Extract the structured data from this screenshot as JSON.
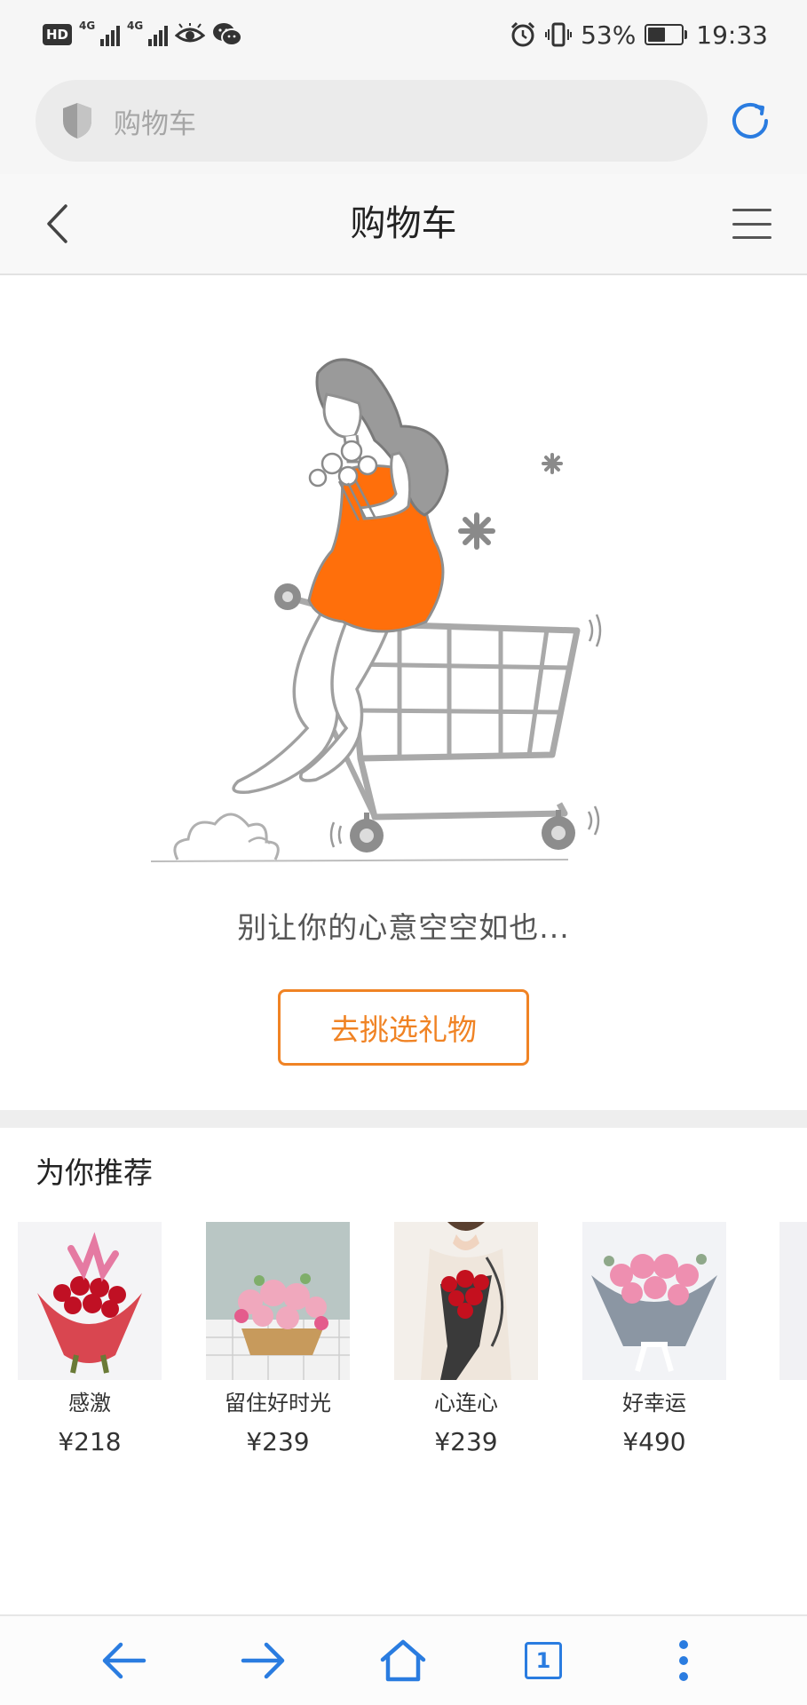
{
  "status_bar": {
    "hd": "HD",
    "sim1_label": "4G",
    "sim2_label": "4G",
    "battery_percent": "53%",
    "battery_level": 0.53,
    "time": "19:33"
  },
  "url_bar": {
    "text": "购物车"
  },
  "header": {
    "title": "购物车"
  },
  "empty_cart": {
    "message": "别让你的心意空空如也...",
    "button_label": "去挑选礼物"
  },
  "recommendations": {
    "title": "为你推荐",
    "items": [
      {
        "name": "感激",
        "price": "¥218"
      },
      {
        "name": "留住好时光",
        "price": "¥239"
      },
      {
        "name": "心连心",
        "price": "¥239"
      },
      {
        "name": "好幸运",
        "price": "¥490"
      }
    ]
  },
  "bottom_nav": {
    "tab_count": "1"
  },
  "colors": {
    "accent_orange": "#f08324",
    "browser_blue": "#2a7ce0",
    "dress_orange": "#ff6f0b"
  }
}
